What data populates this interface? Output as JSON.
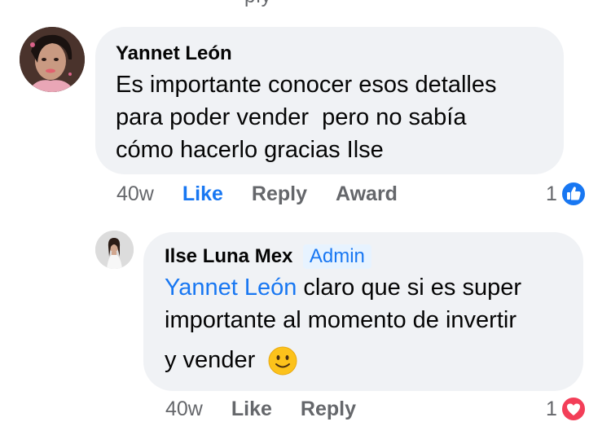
{
  "top_cut_text": "ply",
  "comments": [
    {
      "author": "Yannet León",
      "text": "Es importante conocer esos detalles para poder vender  pero no sabía cómo hacerlo gracias Ilse",
      "text_lines": [
        "Es importante conocer esos detalles",
        "para poder vender  pero no sabía",
        "cómo hacerlo gracias Ilse"
      ],
      "timestamp": "40w",
      "like_label": "Like",
      "reply_label": "Reply",
      "award_label": "Award",
      "reaction_count": "1",
      "reaction_icon": "like-icon",
      "liked_by_viewer": true
    },
    {
      "author": "Ilse Luna Mex",
      "badge": "Admin",
      "mention": "Yannet León",
      "text_lines": [
        "claro que si es super",
        "importante al momento de invertir",
        "y vender"
      ],
      "emoji": "slightly-smiling-face-icon",
      "timestamp": "40w",
      "like_label": "Like",
      "reply_label": "Reply",
      "reaction_count": "1",
      "reaction_icon": "love-icon"
    }
  ],
  "colors": {
    "accent": "#1877f2",
    "bubble": "#f0f2f5",
    "muted": "#65676b",
    "love": "#f33e58"
  }
}
